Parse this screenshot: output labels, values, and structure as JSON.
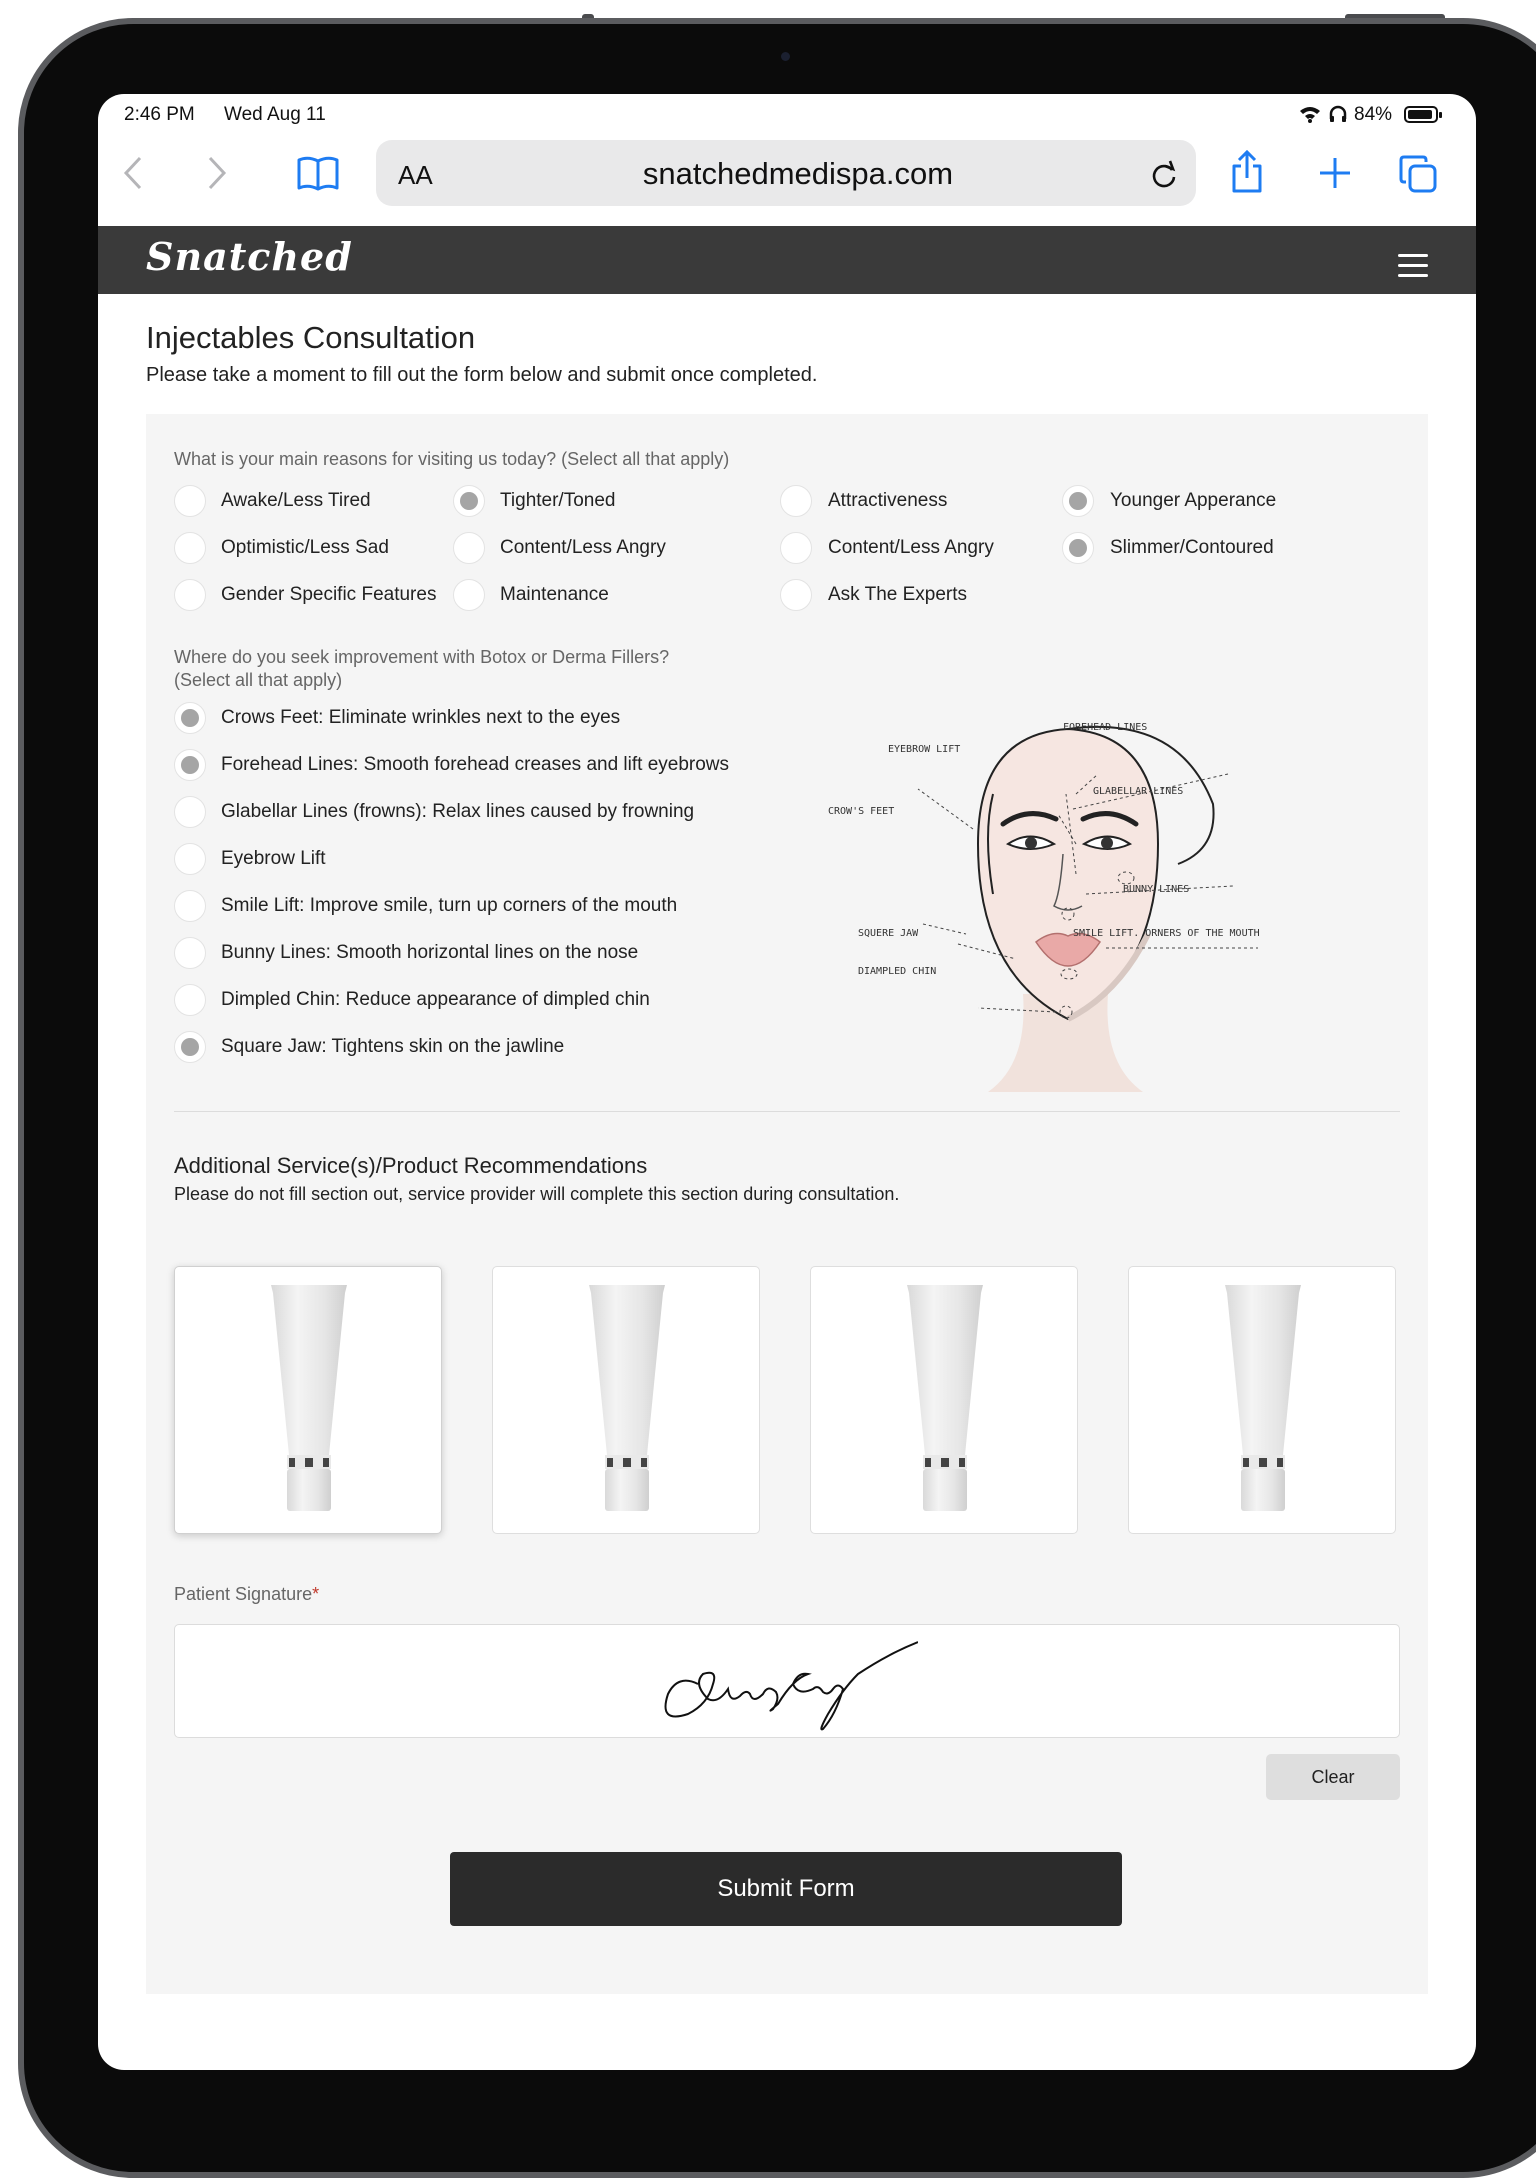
{
  "status_bar": {
    "time": "2:46 PM",
    "date": "Wed Aug 11",
    "battery": "84%"
  },
  "browser": {
    "text_size_label": "AA",
    "url": "snatchedmedispa.com"
  },
  "site": {
    "logo": "Snatched"
  },
  "page": {
    "title": "Injectables Consultation",
    "subtitle": "Please take a moment to fill out the form below and submit once completed."
  },
  "reasons": {
    "question": "What is your main reasons for visiting us today? (Select all that apply)",
    "options": [
      {
        "label": "Awake/Less Tired",
        "checked": false
      },
      {
        "label": "Tighter/Toned",
        "checked": true
      },
      {
        "label": "Attractiveness",
        "checked": false
      },
      {
        "label": "Younger Apperance",
        "checked": true
      },
      {
        "label": "Optimistic/Less Sad",
        "checked": false
      },
      {
        "label": "Content/Less Angry",
        "checked": false
      },
      {
        "label": "Content/Less Angry",
        "checked": false
      },
      {
        "label": "Slimmer/Contoured",
        "checked": true
      },
      {
        "label": "Gender Specific Features",
        "checked": false
      },
      {
        "label": "Maintenance",
        "checked": false
      },
      {
        "label": "Ask The Experts",
        "checked": false
      }
    ]
  },
  "improvement": {
    "question": "Where do you seek improvement with Botox or Derma Fillers?",
    "question_note": "(Select all that apply)",
    "options": [
      {
        "label": "Crows Feet: Eliminate wrinkles next to the eyes",
        "checked": true
      },
      {
        "label": "Forehead Lines: Smooth forehead creases and lift eyebrows",
        "checked": true
      },
      {
        "label": "Glabellar Lines (frowns): Relax lines caused by frowning",
        "checked": false
      },
      {
        "label": "Eyebrow Lift",
        "checked": false
      },
      {
        "label": "Smile Lift: Improve smile, turn up corners of the mouth",
        "checked": false
      },
      {
        "label": "Bunny Lines: Smooth horizontal lines on the nose",
        "checked": false
      },
      {
        "label": "Dimpled Chin: Reduce appearance of dimpled chin",
        "checked": false
      },
      {
        "label": "Square Jaw: Tightens skin on the jawline",
        "checked": true
      }
    ],
    "diagram_labels": {
      "forehead": "FOREHEAD LINES",
      "eyebrow": "EYEBROW LIFT",
      "glabellar": "GLABELLAR LINES",
      "crows": "CROW'S FEET",
      "bunny": "BUNNY LINES",
      "jaw": "SQUERE JAW",
      "smile": "SMILE LIFT. ORNERS OF THE MOUTH",
      "chin": "DIAMPLED CHIN"
    }
  },
  "recommendations": {
    "title": "Additional Service(s)/Product Recommendations",
    "subtitle": "Please do not fill section out, service provider will complete this section during consultation.",
    "selected_index": 0
  },
  "signature": {
    "label": "Patient Signature",
    "required_mark": "*",
    "clear_label": "Clear"
  },
  "submit_label": "Submit Form"
}
